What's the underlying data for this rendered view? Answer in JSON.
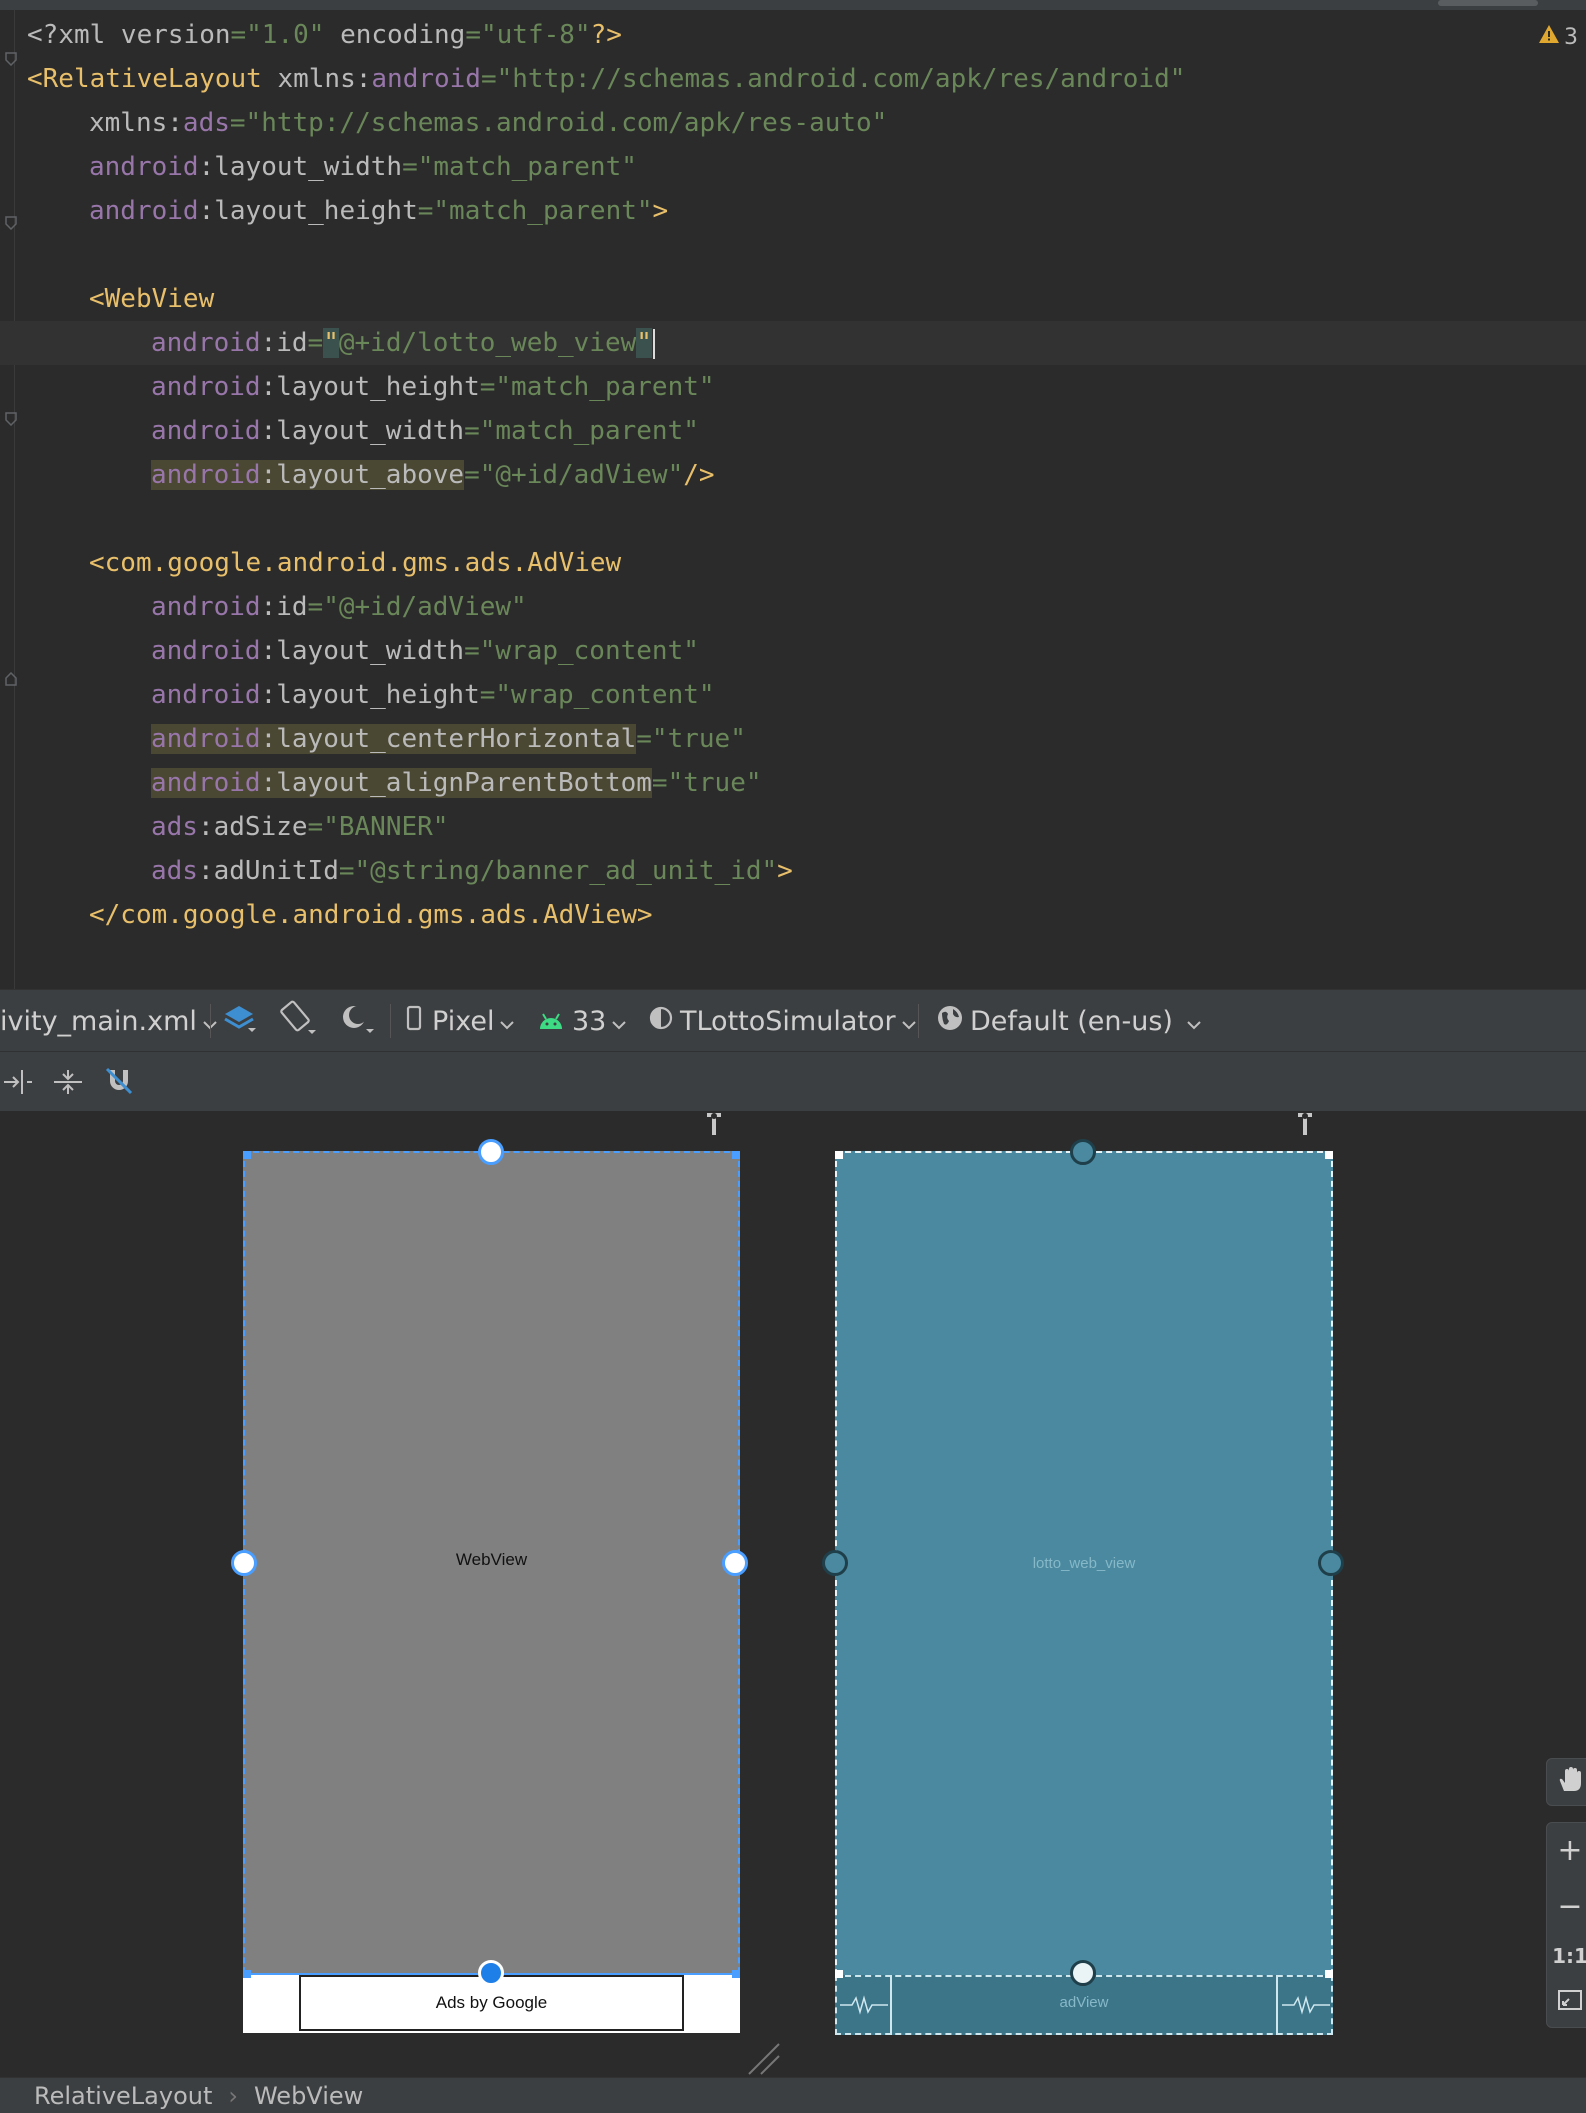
{
  "editor": {
    "warning_count": "3",
    "lines": {
      "l1": {
        "p1": "<?",
        "p2": "xml version",
        "p3": "=",
        "p4": "\"1.0\"",
        "p5": " encoding",
        "p6": "=",
        "p7": "\"utf-8\"",
        "p8": "?>"
      },
      "l2": {
        "tag": "<RelativeLayout",
        "sp": " xmlns:",
        "ns": "android",
        "eq": "=",
        "val": "\"http://schemas.android.com/apk/res/android\""
      },
      "l3": {
        "attr": "xmlns:",
        "ns": "ads",
        "eq": "=",
        "val": "\"http://schemas.android.com/apk/res-auto\""
      },
      "l4": {
        "ns": "android",
        "attr": ":layout_width",
        "eq": "=",
        "val": "\"match_parent\""
      },
      "l5": {
        "ns": "android",
        "attr": ":layout_height",
        "eq": "=",
        "val": "\"match_parent\"",
        "end": ">"
      },
      "l7": {
        "tag": "<WebView"
      },
      "l8": {
        "ns": "android",
        "attr": ":id",
        "eq": "=",
        "q1": "\"",
        "val": "@+id/lotto_web_view",
        "q2": "\""
      },
      "l9": {
        "ns": "android",
        "attr": ":layout_height",
        "eq": "=",
        "val": "\"match_parent\""
      },
      "l10": {
        "ns": "android",
        "attr": ":layout_width",
        "eq": "=",
        "val": "\"match_parent\""
      },
      "l11": {
        "ns": "android",
        "attr": ":layout_above",
        "eq": "=",
        "val": "\"@+id/adView\"",
        "end": "/>"
      },
      "l13": {
        "tag": "<com.google.android.gms.ads.AdView"
      },
      "l14": {
        "ns": "android",
        "attr": ":id",
        "eq": "=",
        "val": "\"@+id/adView\""
      },
      "l15": {
        "ns": "android",
        "attr": ":layout_width",
        "eq": "=",
        "val": "\"wrap_content\""
      },
      "l16": {
        "ns": "android",
        "attr": ":layout_height",
        "eq": "=",
        "val": "\"wrap_content\""
      },
      "l17": {
        "ns": "android",
        "attr": ":layout_centerHorizontal",
        "eq": "=",
        "val": "\"true\""
      },
      "l18": {
        "ns": "android",
        "attr": ":layout_alignParentBottom",
        "eq": "=",
        "val": "\"true\""
      },
      "l19": {
        "ns": "ads",
        "attr": ":adSize",
        "eq": "=",
        "val": "\"BANNER\""
      },
      "l20": {
        "ns": "ads",
        "attr": ":adUnitId",
        "eq": "=",
        "val": "\"@string/banner_ad_unit_id\"",
        "end": ">"
      },
      "l21": {
        "tag": "</com.google.android.gms.ads.AdView>"
      }
    }
  },
  "toolbar": {
    "file": "ivity_main.xml",
    "device": "Pixel",
    "api": "33",
    "theme": "TLottoSimulator",
    "locale": "Default (en-us)"
  },
  "design": {
    "webview_label": "WebView",
    "ad_label": "Ads by Google"
  },
  "blueprint": {
    "webview_label": "lotto_web_view",
    "ad_label": "adView"
  },
  "side": {
    "plus": "+",
    "minus": "−",
    "one_to_one": "1:1"
  },
  "breadcrumb": {
    "root": "RelativeLayout",
    "sep": "›",
    "child": "WebView"
  },
  "colors": {
    "editor_bg": "#2b2b2b",
    "tag": "#e8bf6a",
    "namespace": "#9876aa",
    "string": "#6a8759",
    "webview_fill": "#808080",
    "blueprint_fill": "#4a899f",
    "selection": "#4a9eff"
  },
  "icons": [
    "warning-icon",
    "bulb-icon",
    "layers-icon",
    "orientation-icon",
    "night-mode-icon",
    "phone-icon",
    "android-icon",
    "theme-icon",
    "globe-icon",
    "hand-icon",
    "fit-screen-icon"
  ]
}
